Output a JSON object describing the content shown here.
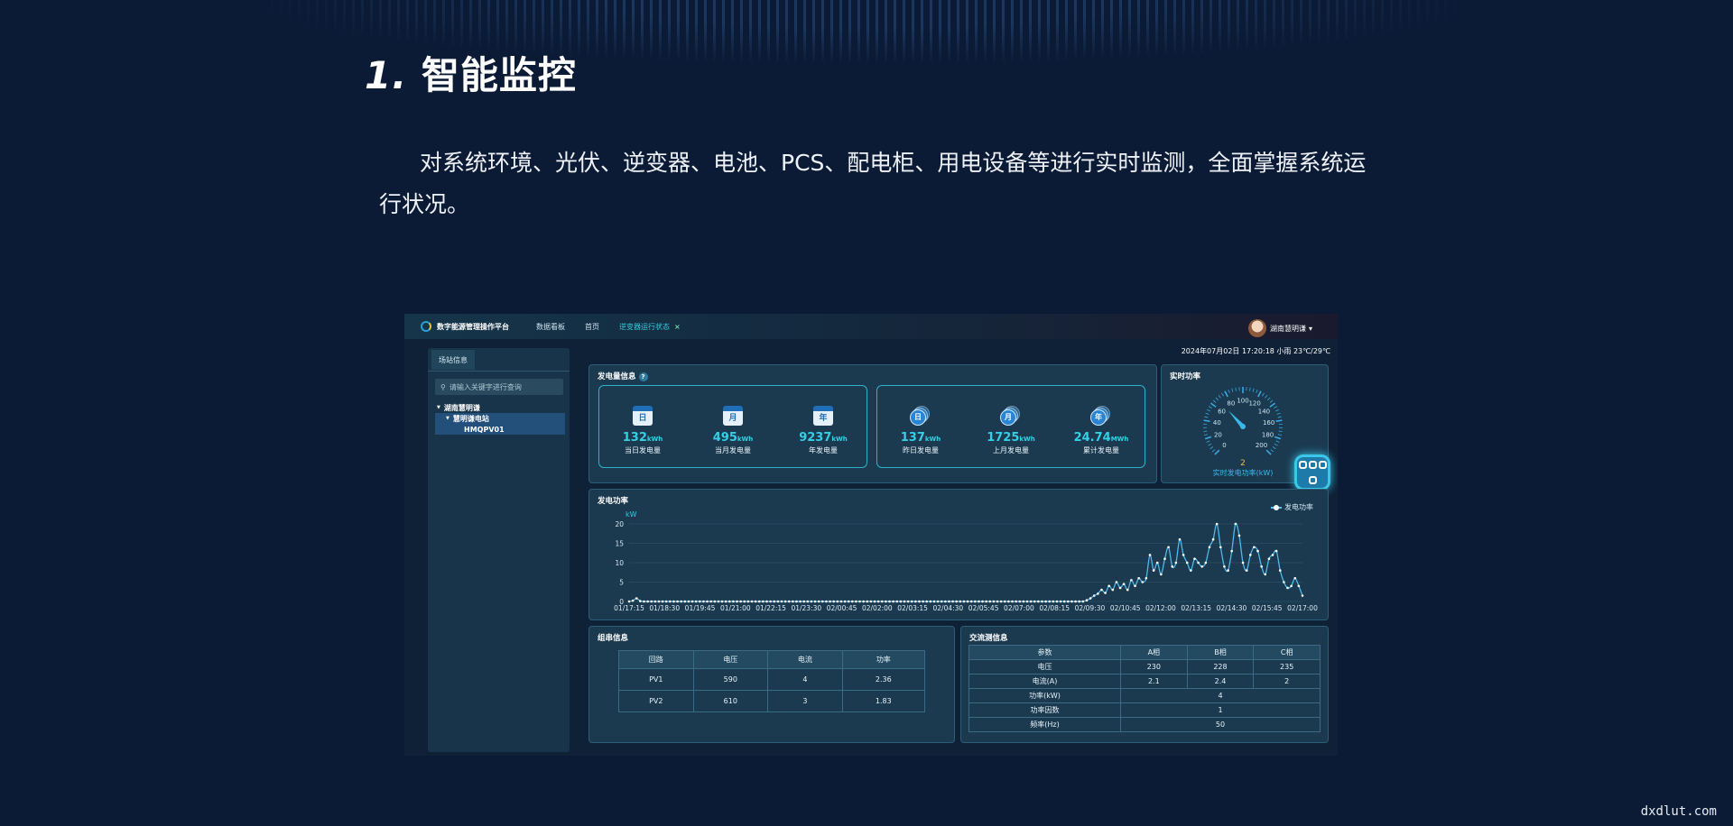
{
  "heading": {
    "number": "1.",
    "title": "智能监控"
  },
  "description": "对系统环境、光伏、逆变器、电池、PCS、配电柜、用电设备等进行实时监测，全面掌握系统运行状况。",
  "watermark": "dxdlut.com",
  "app": {
    "title": "数字能源管理操作平台",
    "nav": [
      "数据看板",
      "首页",
      "逆变器运行状态"
    ],
    "close_glyph": "×",
    "user": "湖南慧明谦",
    "user_caret": "▾",
    "info_line": "2024年07月02日 17:20:18  小雨  23℃/29℃",
    "sidebar": {
      "tab": "场站信息",
      "search_placeholder": "请输入关键字进行查询",
      "tree": [
        {
          "label": "湖南慧明谦",
          "level": 0
        },
        {
          "label": "慧明谦电站",
          "level": 1
        },
        {
          "label": "HMQPV01",
          "level": 2
        }
      ]
    },
    "generation": {
      "title": "发电量信息",
      "help": "?",
      "today": [
        {
          "icon": "日",
          "value": "132",
          "unit": "kWh",
          "label": "当日发电量"
        },
        {
          "icon": "月",
          "value": "495",
          "unit": "kWh",
          "label": "当月发电量"
        },
        {
          "icon": "年",
          "value": "9237",
          "unit": "kWh",
          "label": "年发电量"
        }
      ],
      "history": [
        {
          "icon": "日",
          "value": "137",
          "unit": "kWh",
          "label": "昨日发电量"
        },
        {
          "icon": "月",
          "value": "1725",
          "unit": "kWh",
          "label": "上月发电量"
        },
        {
          "icon": "年",
          "value": "24.74",
          "unit": "MWh",
          "label": "累计发电量"
        }
      ]
    },
    "realtime": {
      "title": "实时功率",
      "ticks": [
        "0",
        "20",
        "40",
        "60",
        "80",
        "100",
        "120",
        "140",
        "160",
        "180",
        "200"
      ],
      "value": "2",
      "label": "实时发电功率(kW)"
    },
    "power_chart_title": "发电功率",
    "strings": {
      "title": "组串信息",
      "headers": [
        "回路",
        "电压",
        "电流",
        "功率"
      ],
      "rows": [
        [
          "PV1",
          "590",
          "4",
          "2.36"
        ],
        [
          "PV2",
          "610",
          "3",
          "1.83"
        ]
      ]
    },
    "ac": {
      "title": "交流测信息",
      "headers": [
        "参数",
        "A相",
        "B相",
        "C相"
      ],
      "rows3": [
        [
          "电压",
          "230",
          "228",
          "235"
        ],
        [
          "电流(A)",
          "2.1",
          "2.4",
          "2"
        ]
      ],
      "rows1": [
        [
          "功率(kW)",
          "4"
        ],
        [
          "功率因数",
          "1"
        ],
        [
          "频率(Hz)",
          "50"
        ]
      ]
    }
  },
  "chart_data": {
    "type": "line",
    "ylabel": "kW",
    "ylim": [
      0,
      20
    ],
    "yticks": [
      "0",
      "5",
      "10",
      "15",
      "20"
    ],
    "xticks": [
      "01/17:15",
      "01/18:30",
      "01/19:45",
      "01/21:00",
      "01/22:15",
      "01/23:30",
      "02/00:45",
      "02/02:00",
      "02/03:15",
      "02/04:30",
      "02/05:45",
      "02/07:00",
      "02/08:15",
      "02/09:30",
      "02/10:45",
      "02/12:00",
      "02/13:15",
      "02/14:30",
      "02/15:45",
      "02/17:00"
    ],
    "series": [
      {
        "name": "发电功率",
        "values": [
          0,
          0.2,
          0.8,
          0.1,
          0,
          0,
          0,
          0,
          0,
          0,
          0,
          0,
          0,
          0,
          0,
          0,
          0,
          0,
          0,
          0,
          0,
          0,
          0,
          0,
          0,
          0,
          0,
          0,
          0,
          0,
          0,
          0,
          0,
          0,
          0,
          0,
          0,
          0,
          0,
          0,
          0,
          0,
          0,
          0,
          0,
          0,
          0,
          0,
          0,
          0,
          0,
          0,
          0,
          0,
          0,
          0,
          0,
          0,
          0,
          0,
          0,
          0,
          0,
          0,
          0,
          0,
          0,
          0,
          0,
          0,
          0,
          0,
          0,
          0,
          0,
          0,
          0,
          0,
          0,
          0,
          0,
          0,
          0,
          0,
          0,
          0,
          0,
          0,
          0,
          0,
          0,
          0,
          0,
          0,
          0,
          0,
          0,
          0,
          0,
          0,
          0,
          0,
          0,
          0,
          0,
          0,
          0,
          0,
          0,
          0,
          0,
          0,
          0,
          0,
          0,
          0,
          0,
          0,
          0,
          0,
          0,
          0,
          0,
          0.3,
          0.8,
          1.5,
          2,
          3,
          2.2,
          4,
          3,
          5,
          3.5,
          4.5,
          3,
          5.5,
          4,
          6,
          5,
          6,
          12,
          8,
          10,
          7,
          11,
          14,
          9,
          10,
          16,
          12,
          10,
          8,
          11,
          10,
          9,
          10,
          14,
          16,
          20,
          14,
          9,
          8,
          13,
          20,
          17,
          10,
          8,
          12,
          14,
          13,
          9,
          7,
          11,
          12,
          13,
          8,
          5,
          3.5,
          4,
          6,
          4,
          1.5
        ]
      }
    ]
  }
}
